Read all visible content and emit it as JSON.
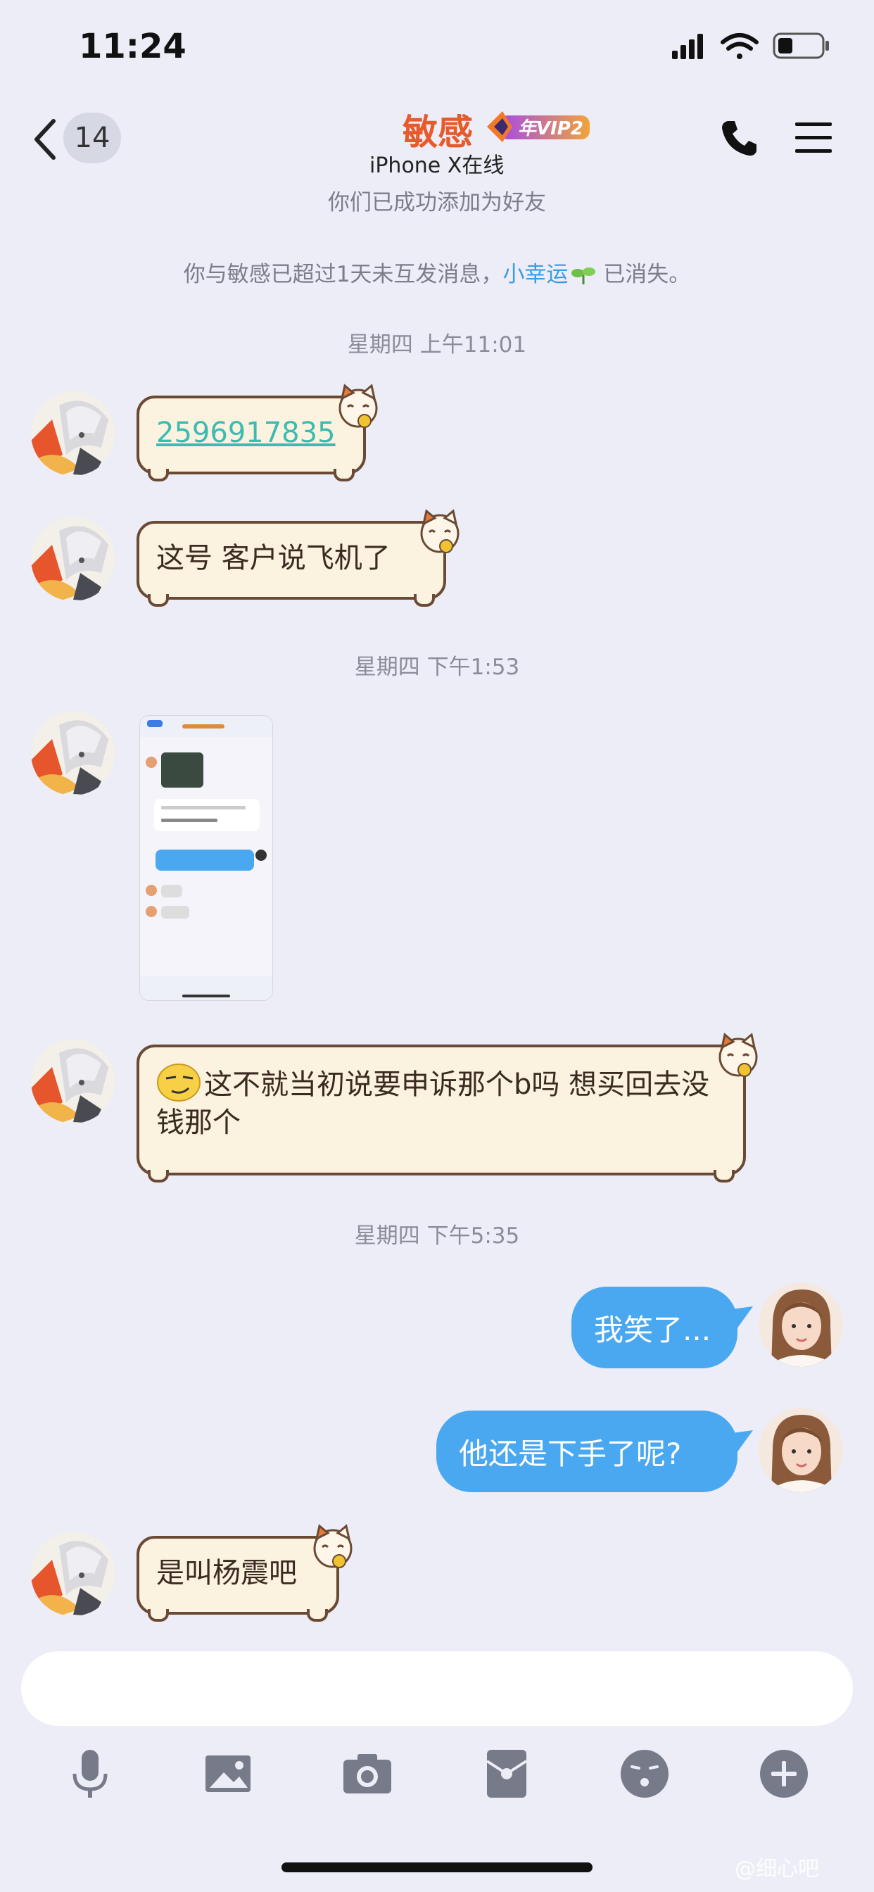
{
  "status": {
    "time": "11:24"
  },
  "header": {
    "unread_count": "14",
    "contact_name": "敏感",
    "vip_badge": "年VIP2",
    "online_status": "iPhone X在线"
  },
  "notices": {
    "added": "你们已成功添加为好友",
    "lucky_prefix": "你与敏感已超过1天未互发消息，",
    "lucky_link": "小幸运",
    "lucky_suffix": " 已消失。"
  },
  "timestamps": [
    "星期四 上午11:01",
    "星期四 下午1:53",
    "星期四 下午5:35"
  ],
  "messages": [
    {
      "side": "left",
      "text": "2596917835",
      "is_link": true
    },
    {
      "side": "left",
      "text": "这号 客户说飞机了"
    },
    {
      "side": "left",
      "type": "image"
    },
    {
      "side": "left",
      "text": "这不就当初说要申诉那个b吗  想买回去没钱那个",
      "emoji": "smirk-emoji"
    },
    {
      "side": "right",
      "text": "我笑了..."
    },
    {
      "side": "right",
      "text": "他还是下手了呢?"
    },
    {
      "side": "left",
      "text": "是叫杨震吧"
    }
  ],
  "toolbar": [
    "microphone-icon",
    "image-icon",
    "camera-icon",
    "red-packet-icon",
    "emoji-icon",
    "plus-icon"
  ],
  "watermark": "@细心吧",
  "colors": {
    "accent_blue": "#4aa8f1",
    "name_orange": "#e65a2c",
    "bubble_border": "#6b4a35"
  }
}
